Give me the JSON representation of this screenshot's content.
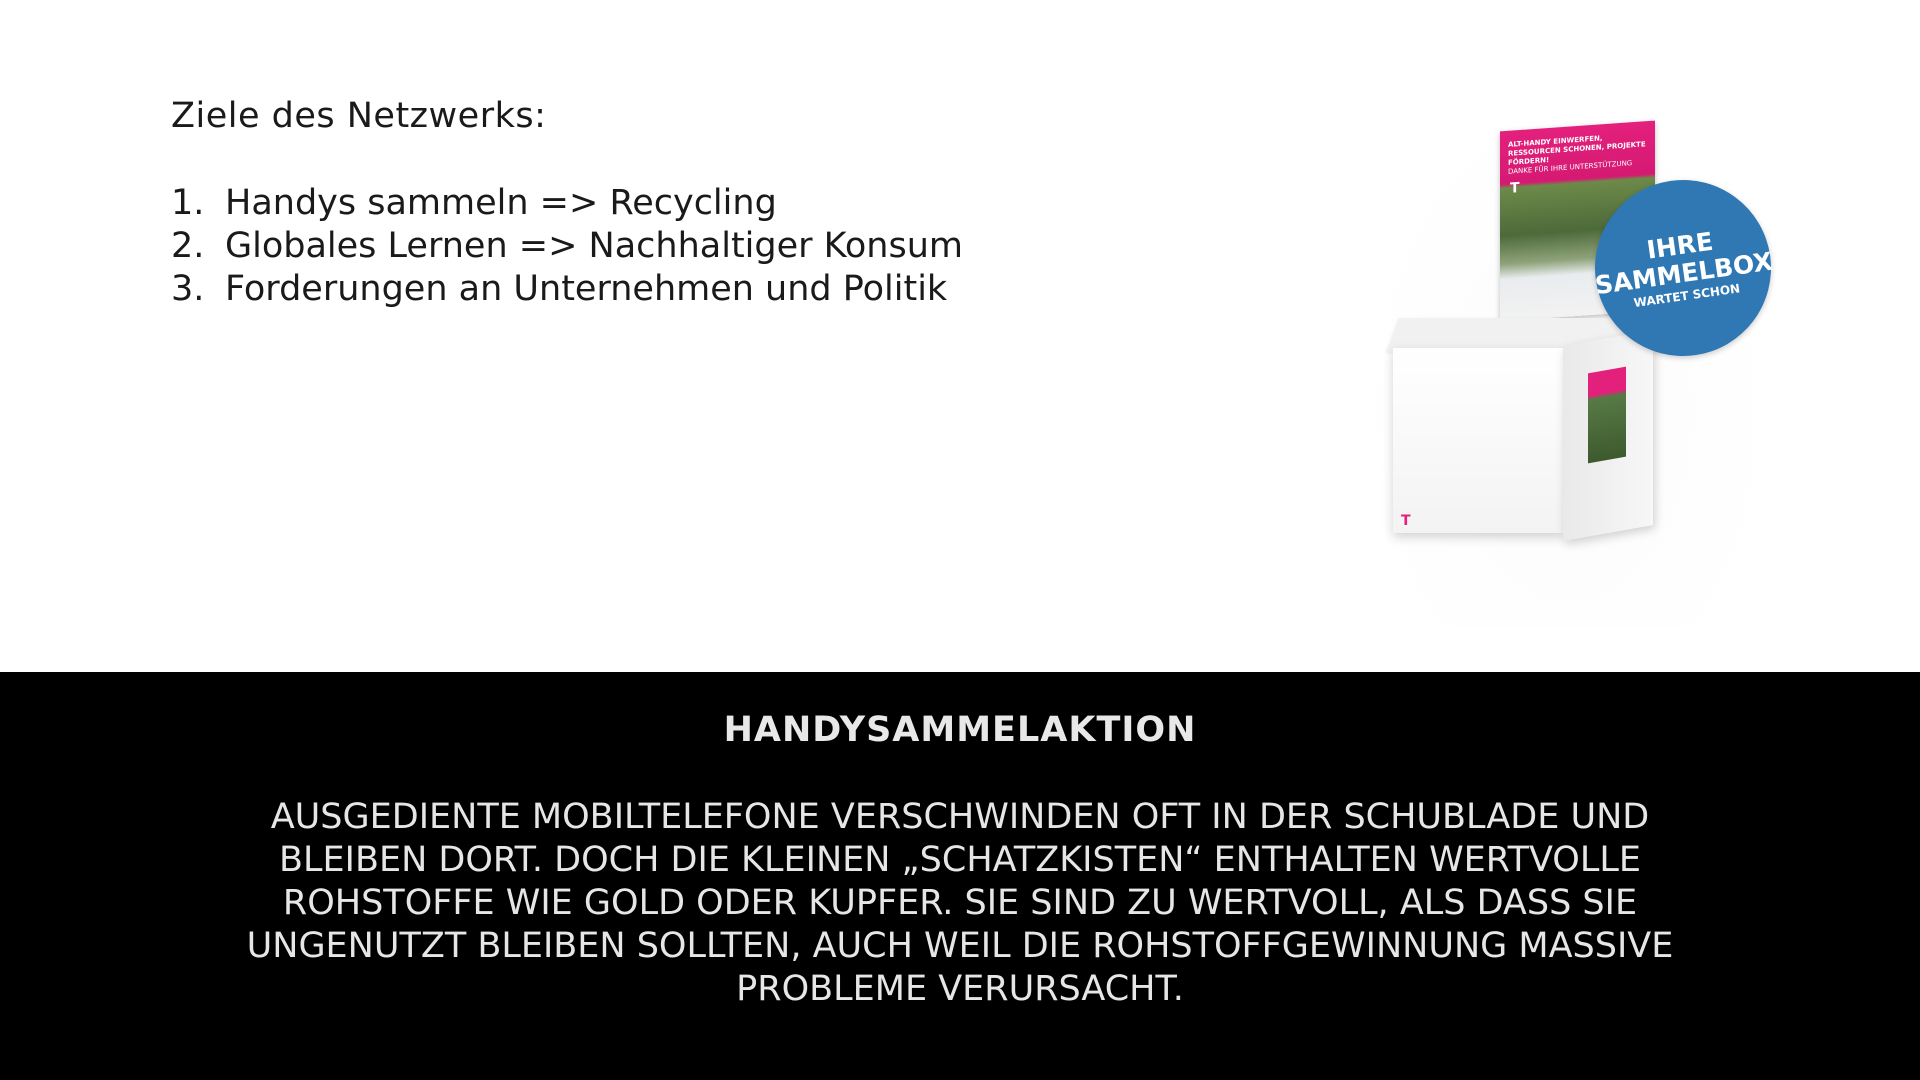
{
  "slide": {
    "heading": "Ziele des Netzwerks:",
    "goals": [
      {
        "num": "1.",
        "text": "Handys sammeln => Recycling"
      },
      {
        "num": "2.",
        "text": "Globales Lernen => Nachhaltiger Konsum"
      },
      {
        "num": "3.",
        "text": "Forderungen an Unternehmen und Politik"
      }
    ],
    "product_image": {
      "poster_text": "ALT-HANDY EINWERFEN, RESSOURCEN SCHONEN, PROJEKTE FÖRDERN!",
      "poster_subtext": "DANKE FÜR IHRE UNTERSTÜTZUNG",
      "logo": "T",
      "badge": {
        "line1": "IHRE",
        "line2": "SAMMELBOX",
        "line3": "WARTET SCHON"
      },
      "brand_color": "#e4207d",
      "badge_color": "#2f78b4"
    }
  },
  "caption": {
    "title": "HANDYSAMMELAKTION",
    "text": "AUSGEDIENTE MOBILTELEFONE VERSCHWINDEN OFT IN DER SCHUBLADE UND BLEIBEN DORT. DOCH DIE KLEINEN „SCHATZKISTEN“ ENTHALTEN WERTVOLLE ROHSTOFFE WIE GOLD ODER KUPFER. SIE SIND ZU WERTVOLL, ALS DASS SIE UNGENUTZT BLEIBEN SOLLTEN, AUCH WEIL DIE ROHSTOFFGEWINNUNG MASSIVE PROBLEME VERURSACHT."
  }
}
